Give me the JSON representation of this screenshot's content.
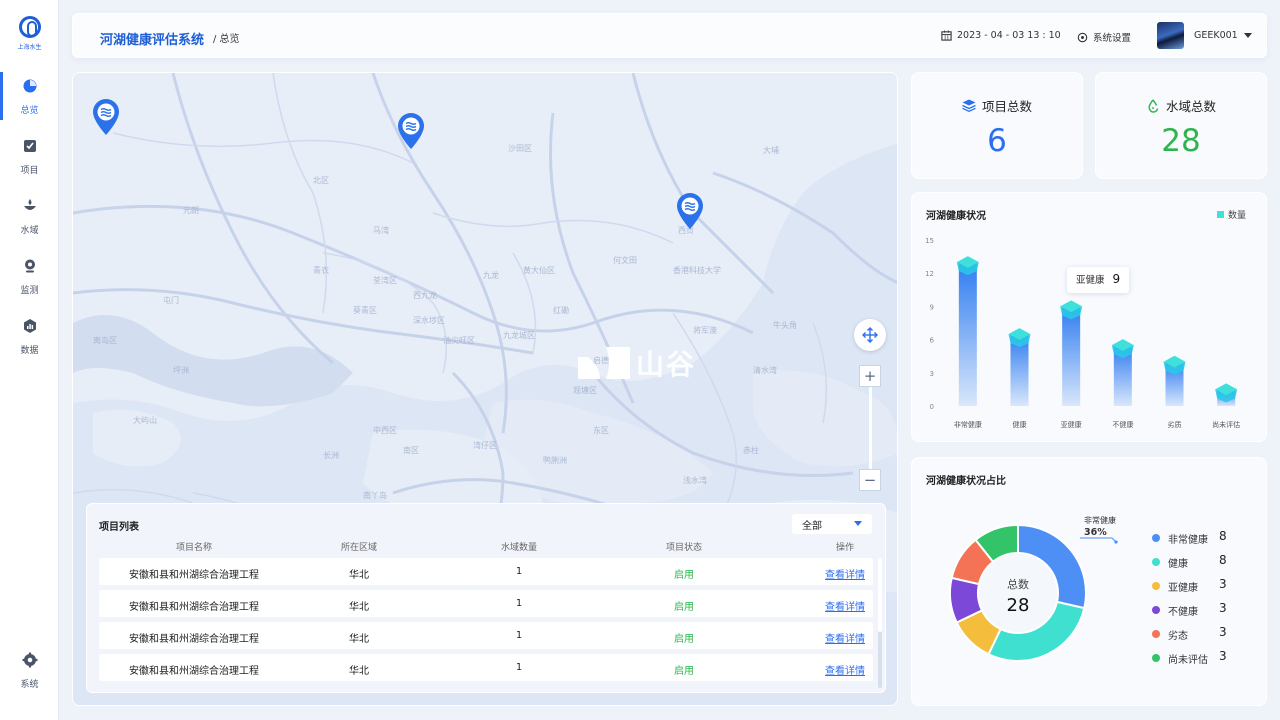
{
  "sidebar": {
    "logo_text": "上海水生",
    "items": [
      {
        "label": "总览",
        "icon": "dashboard-icon"
      },
      {
        "label": "项目",
        "icon": "project-icon"
      },
      {
        "label": "水域",
        "icon": "water-icon"
      },
      {
        "label": "监测",
        "icon": "monitor-icon"
      },
      {
        "label": "数据",
        "icon": "data-icon"
      }
    ],
    "bottom_item": {
      "label": "系统",
      "icon": "gear-icon"
    }
  },
  "header": {
    "title": "河湖健康评估系统",
    "breadcrumb": "/ 总览",
    "datetime": "2023 - 04 - 03  13 : 10",
    "settings_label": "系统设置",
    "username": "GEEK001"
  },
  "map": {
    "watermark": "山谷",
    "zoom_in": "+",
    "zoom_out": "−",
    "labels": [
      "沙田区",
      "北区",
      "元朗",
      "屯门",
      "荃湾区",
      "葵青区",
      "深水埗区",
      "九龙城区",
      "油尖旺区",
      "观塘区",
      "黄大仙区",
      "中西区",
      "湾仔区",
      "东区",
      "南区",
      "离岛区",
      "西贡",
      "清水湾",
      "大屿山",
      "九龙",
      "长洲",
      "南丫岛",
      "西九龙",
      "何文田",
      "将军澳",
      "坪洲",
      "马湾",
      "青衣",
      "大埔",
      "香港科技大学",
      "牛头角",
      "红磡",
      "启德",
      "赤柱",
      "浅水湾",
      "鸭脷洲"
    ]
  },
  "project_list": {
    "title": "项目列表",
    "filter": "全部",
    "columns": [
      "项目名称",
      "所在区域",
      "水域数量",
      "项目状态",
      "操作"
    ],
    "rows": [
      {
        "name": "安徽和县和州湖综合治理工程",
        "region": "华北",
        "count": "1",
        "status": "启用",
        "action": "查看详情"
      },
      {
        "name": "安徽和县和州湖综合治理工程",
        "region": "华北",
        "count": "1",
        "status": "启用",
        "action": "查看详情"
      },
      {
        "name": "安徽和县和州湖综合治理工程",
        "region": "华北",
        "count": "1",
        "status": "启用",
        "action": "查看详情"
      },
      {
        "name": "安徽和县和州湖综合治理工程",
        "region": "华北",
        "count": "1",
        "status": "启用",
        "action": "查看详情"
      }
    ]
  },
  "stats": {
    "projects": {
      "label": "项目总数",
      "value": "6",
      "color": "#2b6ff0"
    },
    "waters": {
      "label": "水域总数",
      "value": "28",
      "color": "#2fb54e"
    }
  },
  "chart_data": [
    {
      "type": "bar",
      "title": "河湖健康状况",
      "legend": "数量",
      "categories": [
        "非常健康",
        "健康",
        "亚健康",
        "不健康",
        "劣质",
        "尚未评估"
      ],
      "series": [
        {
          "name": "数量",
          "values": [
            13,
            6.5,
            9,
            5.5,
            4,
            1.5
          ]
        }
      ],
      "yticks": [
        "0",
        "3",
        "6",
        "9",
        "12",
        "15"
      ],
      "ylim": [
        0,
        15
      ],
      "tooltip": {
        "label": "亚健康",
        "value": "9"
      }
    },
    {
      "type": "pie",
      "title": "河湖健康状况占比",
      "center_label": "总数",
      "center_value": "28",
      "callout": {
        "name": "非常健康",
        "percent": "36%"
      },
      "slices": [
        {
          "name": "非常健康",
          "value": 8,
          "color": "#4d8ff5"
        },
        {
          "name": "健康",
          "value": 8,
          "color": "#3fe0d0"
        },
        {
          "name": "亚健康",
          "value": 3,
          "color": "#f5bd3c"
        },
        {
          "name": "不健康",
          "value": 3,
          "color": "#7b48d8"
        },
        {
          "name": "劣态",
          "value": 3,
          "color": "#f47356"
        },
        {
          "name": "尚未评估",
          "value": 3,
          "color": "#33c46a"
        }
      ]
    }
  ]
}
